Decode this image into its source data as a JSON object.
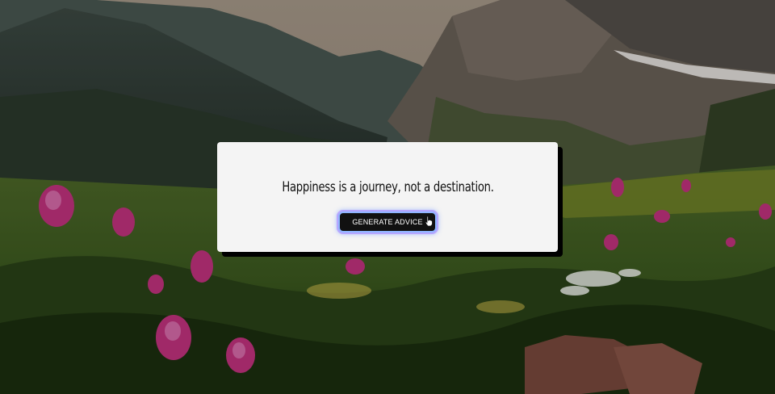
{
  "advice": {
    "text": "Happiness is a journey, not a destination."
  },
  "controls": {
    "generate_label": "GENERATE ADVICE"
  },
  "icons": {
    "cursor": "hand-pointer-icon"
  },
  "colors": {
    "card_background": "#f4f4f4",
    "card_shadow": "#000000",
    "button_background": "#111111",
    "button_text": "#ffffff",
    "button_glow": "#8fb5ff"
  }
}
